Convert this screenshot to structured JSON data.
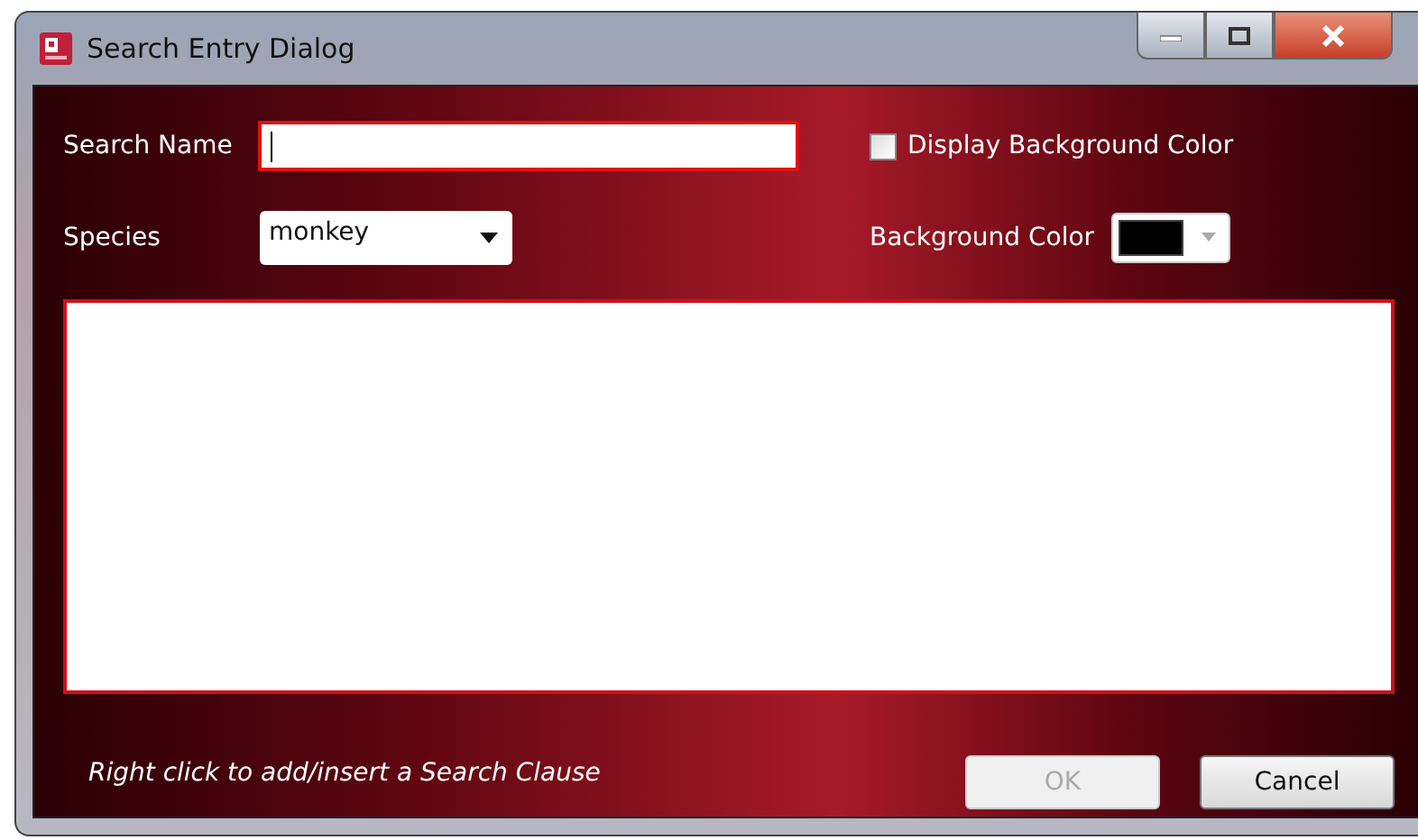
{
  "window": {
    "title": "Search Entry Dialog"
  },
  "search_name": {
    "label": "Search Name"
  },
  "display_background": {
    "label": "Display Background Color",
    "checked": false
  },
  "species": {
    "label": "Species",
    "value": "monkey"
  },
  "background_color": {
    "label": "Background Color",
    "color": "#000000"
  },
  "hint": "Right click to add/insert a Search Clause",
  "buttons": [
    {
      "label": "OK",
      "disabled": true
    },
    {
      "label": "Cancel",
      "disabled": false
    }
  ]
}
